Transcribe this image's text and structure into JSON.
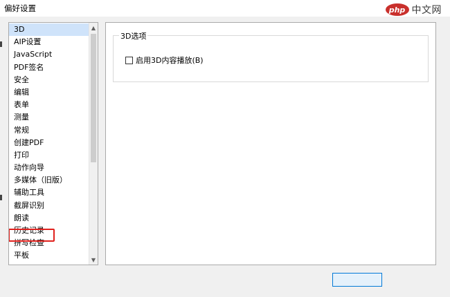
{
  "window": {
    "title": "偏好设置"
  },
  "watermark": {
    "logo": "php",
    "text": "中文网"
  },
  "categories": {
    "selected_index": 0,
    "highlighted_index": 16,
    "items": [
      "3D",
      "AIP设置",
      "JavaScript",
      "PDF签名",
      "安全",
      "编辑",
      "表单",
      "测量",
      "常规",
      "创建PDF",
      "打印",
      "动作向导",
      "多媒体（旧版）",
      "辅助工具",
      "截屏识别",
      "朗读",
      "历史记录",
      "拼写检查",
      "平板"
    ]
  },
  "options_panel": {
    "group_title": "3D选项",
    "checkbox_label": "启用3D内容播放(B)",
    "checkbox_checked": false
  },
  "footer": {
    "ok_label": ""
  },
  "colors": {
    "selection": "#cfe3fa",
    "highlight": "#e0201c",
    "accent": "#0078d7"
  }
}
